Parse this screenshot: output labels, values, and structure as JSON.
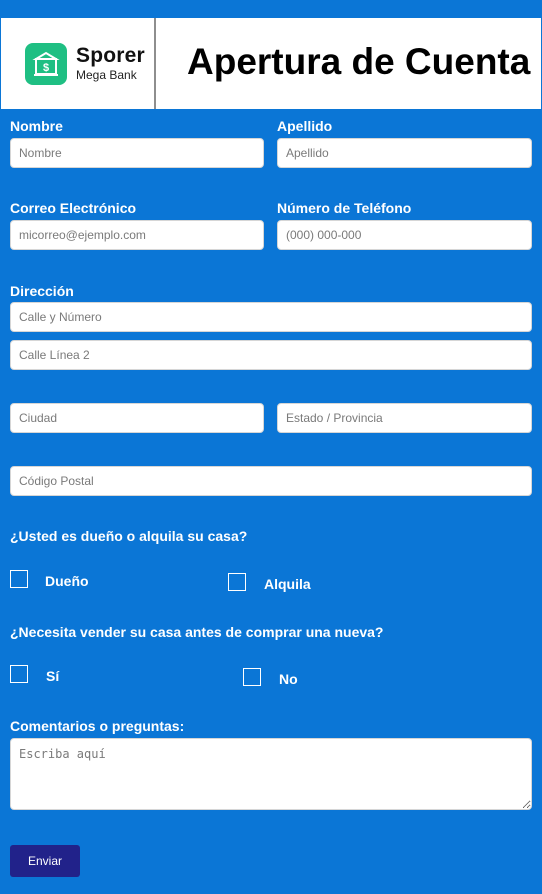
{
  "header": {
    "brand_name": "Sporer",
    "brand_sub": "Mega Bank",
    "title": "Apertura de Cuenta"
  },
  "form": {
    "first_name": {
      "label": "Nombre",
      "placeholder": "Nombre"
    },
    "last_name": {
      "label": "Apellido",
      "placeholder": "Apellido"
    },
    "email": {
      "label": "Correo Electrónico",
      "placeholder": "micorreo@ejemplo.com"
    },
    "phone": {
      "label": "Número de Teléfono",
      "placeholder": "(000) 000-000"
    },
    "address": {
      "label": "Dirección",
      "line1_placeholder": "Calle y Número",
      "line2_placeholder": "Calle Línea 2",
      "city_placeholder": "Ciudad",
      "state_placeholder": "Estado / Provincia",
      "zip_placeholder": "Código Postal"
    },
    "own_or_rent": {
      "question": "¿Usted es dueño o alquila su casa?",
      "options": [
        "Dueño",
        "Alquila"
      ]
    },
    "sell_first": {
      "question": "¿Necesita vender su casa antes de comprar una nueva?",
      "options": [
        "Sí",
        "No"
      ]
    },
    "comments": {
      "label": "Comentarios o preguntas:",
      "placeholder": "Escriba aquí"
    },
    "submit_label": "Enviar"
  }
}
